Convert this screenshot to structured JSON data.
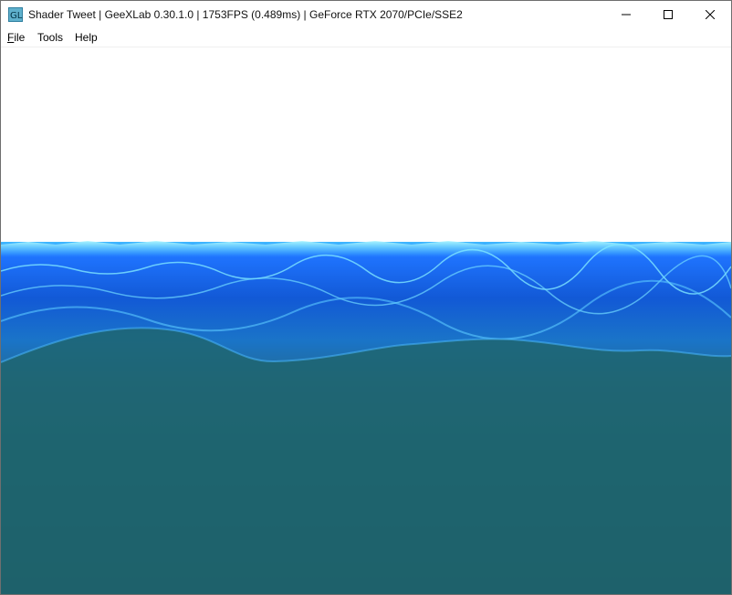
{
  "window": {
    "title": "Shader Tweet | GeeXLab 0.30.1.0 | 1753FPS (0.489ms) | GeForce RTX 2070/PCIe/SSE2",
    "app_icon": "geexlab-icon"
  },
  "titlebar_buttons": {
    "minimize_icon": "minimize-icon",
    "maximize_icon": "maximize-icon",
    "close_icon": "close-icon"
  },
  "menu": {
    "items": [
      {
        "label_prefix": "",
        "accel": "F",
        "label_rest": "ile"
      },
      {
        "label_prefix": "",
        "accel": "",
        "label_rest": "Tools"
      },
      {
        "label_prefix": "",
        "accel": "",
        "label_rest": "Help"
      }
    ]
  },
  "scene": {
    "sky_color": "#ffffff",
    "horizon_foam_color": "#7fe7ff",
    "near_water_color": "#1a7bff",
    "deep_water_color": "#1d5f67",
    "bottom_color": "#1c4c50"
  }
}
